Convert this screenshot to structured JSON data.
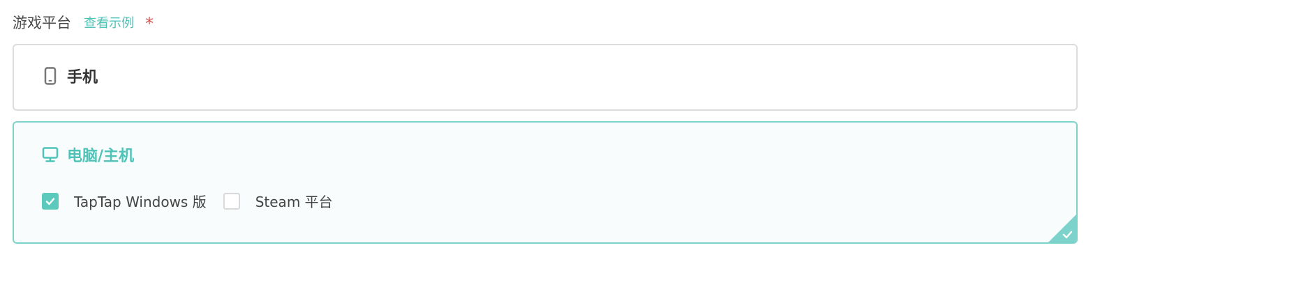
{
  "field": {
    "label": "游戏平台",
    "example_link": "查看示例",
    "required_mark": "*"
  },
  "options": {
    "mobile": {
      "title": "手机",
      "icon": "phone-icon",
      "selected": false
    },
    "pc": {
      "title": "电脑/主机",
      "icon": "monitor-icon",
      "selected": true,
      "checkboxes": [
        {
          "label": "TapTap Windows 版",
          "checked": true
        },
        {
          "label": "Steam 平台",
          "checked": false
        }
      ]
    }
  },
  "colors": {
    "accent": "#4fc3b8",
    "checkbox_fill": "#5cc9bd",
    "selected_border": "#7dd3cb",
    "selected_background": "#f9fcfc",
    "default_border": "#dcdcdc",
    "required": "#d9534f"
  }
}
